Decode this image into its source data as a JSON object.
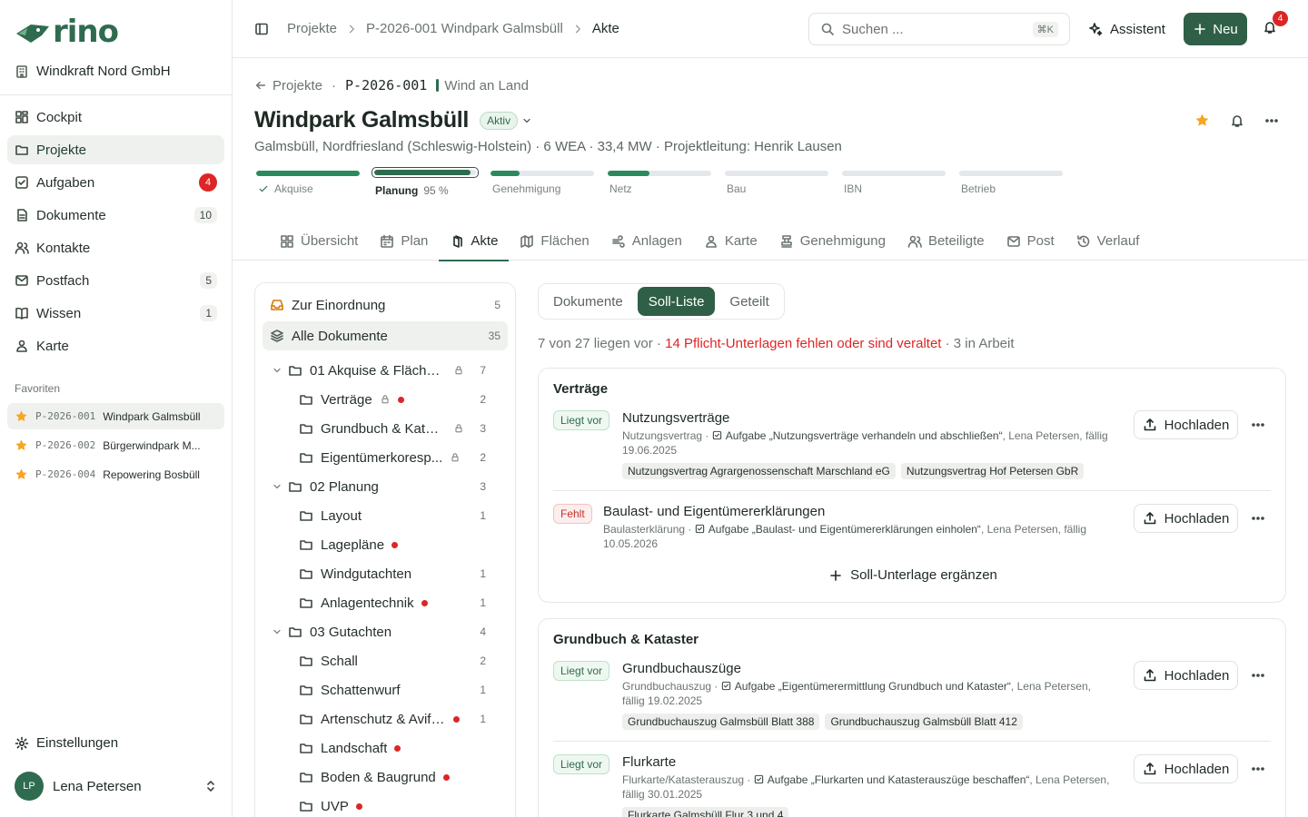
{
  "brand": {
    "name": "rino",
    "accent": "#2f6b4f"
  },
  "org": {
    "name": "Windkraft Nord GmbH",
    "icon": "building-icon"
  },
  "nav": [
    {
      "label": "Cockpit",
      "icon": "dashboard-icon"
    },
    {
      "label": "Projekte",
      "icon": "folder-icon",
      "active": true
    },
    {
      "label": "Aufgaben",
      "icon": "checkbox-icon",
      "badge": "4"
    },
    {
      "label": "Dokumente",
      "icon": "document-icon",
      "count": "10"
    },
    {
      "label": "Kontakte",
      "icon": "contacts-icon"
    },
    {
      "label": "Postfach",
      "icon": "mail-icon",
      "count": "5"
    },
    {
      "label": "Wissen",
      "icon": "book-icon",
      "count": "1"
    },
    {
      "label": "Karte",
      "icon": "map-pin-icon"
    }
  ],
  "favorites": {
    "title": "Favoriten",
    "items": [
      {
        "code": "P-2026-001",
        "name": "Windpark Galmsbüll"
      },
      {
        "code": "P-2026-002",
        "name": "Bürgerwindpark M..."
      },
      {
        "code": "P-2026-004",
        "name": "Repowering Bosbüll"
      }
    ]
  },
  "settings": {
    "label": "Einstellungen"
  },
  "user": {
    "initials": "LP",
    "name": "Lena Petersen"
  },
  "topbar": {
    "breadcrumbs": [
      "Projekte",
      "P-2026-001 Windpark Galmsbüll",
      "Akte"
    ],
    "search_placeholder": "Suchen ...",
    "search_shortcut": "⌘K",
    "assistant": "Assistent",
    "new": "Neu",
    "notifications": "4"
  },
  "project": {
    "back": "Projekte",
    "code": "P-2026-001",
    "category": "Wind an Land",
    "title": "Windpark Galmsbüll",
    "status": "Aktiv",
    "subtitle": "Galmsbüll, Nordfriesland (Schleswig-Holstein) · 6 WEA · 33,4 MW · Projektleitung: Henrik Lausen"
  },
  "phases": [
    {
      "label": "Akquise",
      "progress": 1.0,
      "done": true
    },
    {
      "label": "Planung",
      "progress": 0.95,
      "current": true,
      "pct": "95 %"
    },
    {
      "label": "Genehmigung",
      "progress": 0.28
    },
    {
      "label": "Netz",
      "progress": 0.4
    },
    {
      "label": "Bau",
      "progress": 0
    },
    {
      "label": "IBN",
      "progress": 0
    },
    {
      "label": "Betrieb",
      "progress": 0
    }
  ],
  "tabs": [
    {
      "label": "Übersicht",
      "icon": "grid-icon"
    },
    {
      "label": "Plan",
      "icon": "calendar-icon"
    },
    {
      "label": "Akte",
      "icon": "files-icon",
      "active": true
    },
    {
      "label": "Flächen",
      "icon": "map-icon"
    },
    {
      "label": "Anlagen",
      "icon": "wind-icon"
    },
    {
      "label": "Karte",
      "icon": "map-pin-icon"
    },
    {
      "label": "Genehmigung",
      "icon": "stamp-icon"
    },
    {
      "label": "Beteiligte",
      "icon": "users-icon"
    },
    {
      "label": "Post",
      "icon": "mail-icon"
    },
    {
      "label": "Verlauf",
      "icon": "history-icon"
    }
  ],
  "tree": {
    "inbox": {
      "label": "Zur Einordnung",
      "count": "5"
    },
    "all": {
      "label": "Alle Dokumente",
      "count": "35"
    },
    "nodes": [
      {
        "label": "01 Akquise & Flächen...",
        "count": "7",
        "level": 0,
        "locked": true
      },
      {
        "label": "Verträge",
        "count": "2",
        "level": 1,
        "locked": true,
        "missing": true
      },
      {
        "label": "Grundbuch & Katas...",
        "count": "3",
        "level": 1,
        "locked": true
      },
      {
        "label": "Eigentümerkoresp...",
        "count": "2",
        "level": 1,
        "locked": true
      },
      {
        "label": "02 Planung",
        "count": "3",
        "level": 0
      },
      {
        "label": "Layout",
        "count": "1",
        "level": 1
      },
      {
        "label": "Lagepläne",
        "count": "",
        "level": 1,
        "missing": true
      },
      {
        "label": "Windgutachten",
        "count": "1",
        "level": 1
      },
      {
        "label": "Anlagentechnik",
        "count": "1",
        "level": 1,
        "missing": true
      },
      {
        "label": "03 Gutachten",
        "count": "4",
        "level": 0
      },
      {
        "label": "Schall",
        "count": "2",
        "level": 1
      },
      {
        "label": "Schattenwurf",
        "count": "1",
        "level": 1
      },
      {
        "label": "Artenschutz & Avifa...",
        "count": "1",
        "level": 1,
        "missing": true
      },
      {
        "label": "Landschaft",
        "count": "",
        "level": 1,
        "missing": true
      },
      {
        "label": "Boden & Baugrund",
        "count": "",
        "level": 1,
        "missing": true
      },
      {
        "label": "UVP",
        "count": "",
        "level": 1,
        "missing": true
      }
    ]
  },
  "segments": [
    "Dokumente",
    "Soll-Liste",
    "Geteilt"
  ],
  "summary": {
    "ok": "7 von 27 liegen vor",
    "missing": "14 Pflicht-Unterlagen fehlen oder sind veraltet",
    "progress": "3 in Arbeit"
  },
  "upload_label": "Hochladen",
  "add_label": "Soll-Unterlage ergänzen",
  "cards": [
    {
      "title": "Verträge",
      "items": [
        {
          "status": "Liegt vor",
          "ok": true,
          "name": "Nutzungsverträge",
          "type": "Nutzungsvertrag",
          "task": "Aufgabe „Nutzungsverträge verhandeln und abschließen“",
          "rest": ", Lena Petersen, fällig 19.06.2025",
          "tags": [
            "Nutzungsvertrag Agrargenossenschaft Marschland eG",
            "Nutzungsvertrag Hof Petersen GbR"
          ]
        },
        {
          "status": "Fehlt",
          "ok": false,
          "name": "Baulast- und Eigentümererklärungen",
          "type": "Baulasterklärung",
          "task": "Aufgabe „Baulast- und Eigentümererklärungen einholen“",
          "rest": ", Lena Petersen, fällig 10.05.2026",
          "tags": []
        }
      ]
    },
    {
      "title": "Grundbuch & Kataster",
      "items": [
        {
          "status": "Liegt vor",
          "ok": true,
          "name": "Grundbuchauszüge",
          "type": "Grundbuchauszug",
          "task": "Aufgabe „Eigentümerermittlung Grundbuch und Kataster“",
          "rest": ", Lena Petersen, fällig 19.02.2025",
          "tags": [
            "Grundbuchauszug Galmsbüll Blatt 388",
            "Grundbuchauszug Galmsbüll Blatt 412"
          ]
        },
        {
          "status": "Liegt vor",
          "ok": true,
          "name": "Flurkarte",
          "type": "Flurkarte/Katasterauszug",
          "task": "Aufgabe „Flurkarten und Katasterauszüge beschaffen“",
          "rest": ", Lena Petersen, fällig 30.01.2025",
          "tags": [
            "Flurkarte Galmsbüll Flur 3 und 4"
          ]
        }
      ]
    }
  ]
}
